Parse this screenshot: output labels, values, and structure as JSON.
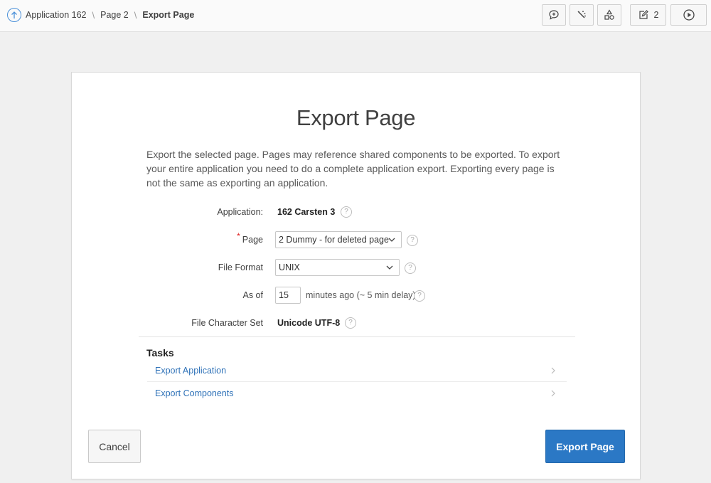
{
  "breadcrumb": {
    "items": [
      "Application 162",
      "Page 2"
    ],
    "current": "Export Page"
  },
  "toolbar": {
    "comment_icon": "speech-bubble-plus-icon",
    "debug_icon": "wand-icon",
    "shared_components_icon": "shapes-icon",
    "edit_icon": "pencil-square-icon",
    "edit_count": "2",
    "run_icon": "play-circle-icon"
  },
  "dialog": {
    "title": "Export Page",
    "intro": "Export the selected page. Pages may reference shared components to be exported. To export your entire application you need to do a complete application export. Exporting every page is not the same as exporting an application.",
    "fields": {
      "application": {
        "label": "Application:",
        "value": "162 Carsten 3"
      },
      "page": {
        "label": "Page",
        "required": "*",
        "value": "2 Dummy - for deleted page"
      },
      "file_format": {
        "label": "File Format",
        "value": "UNIX"
      },
      "as_of": {
        "label": "As of",
        "value": "15",
        "suffix": "minutes ago (~ 5 min delay)"
      },
      "charset": {
        "label": "File Character Set",
        "value": "Unicode UTF-8"
      }
    },
    "help_glyph": "?",
    "tasks": {
      "heading": "Tasks",
      "items": [
        "Export Application",
        "Export Components"
      ]
    },
    "buttons": {
      "cancel": "Cancel",
      "export": "Export Page"
    }
  },
  "colors": {
    "primary": "#2b78c5",
    "link": "#2f72b8",
    "required": "#e02020"
  }
}
